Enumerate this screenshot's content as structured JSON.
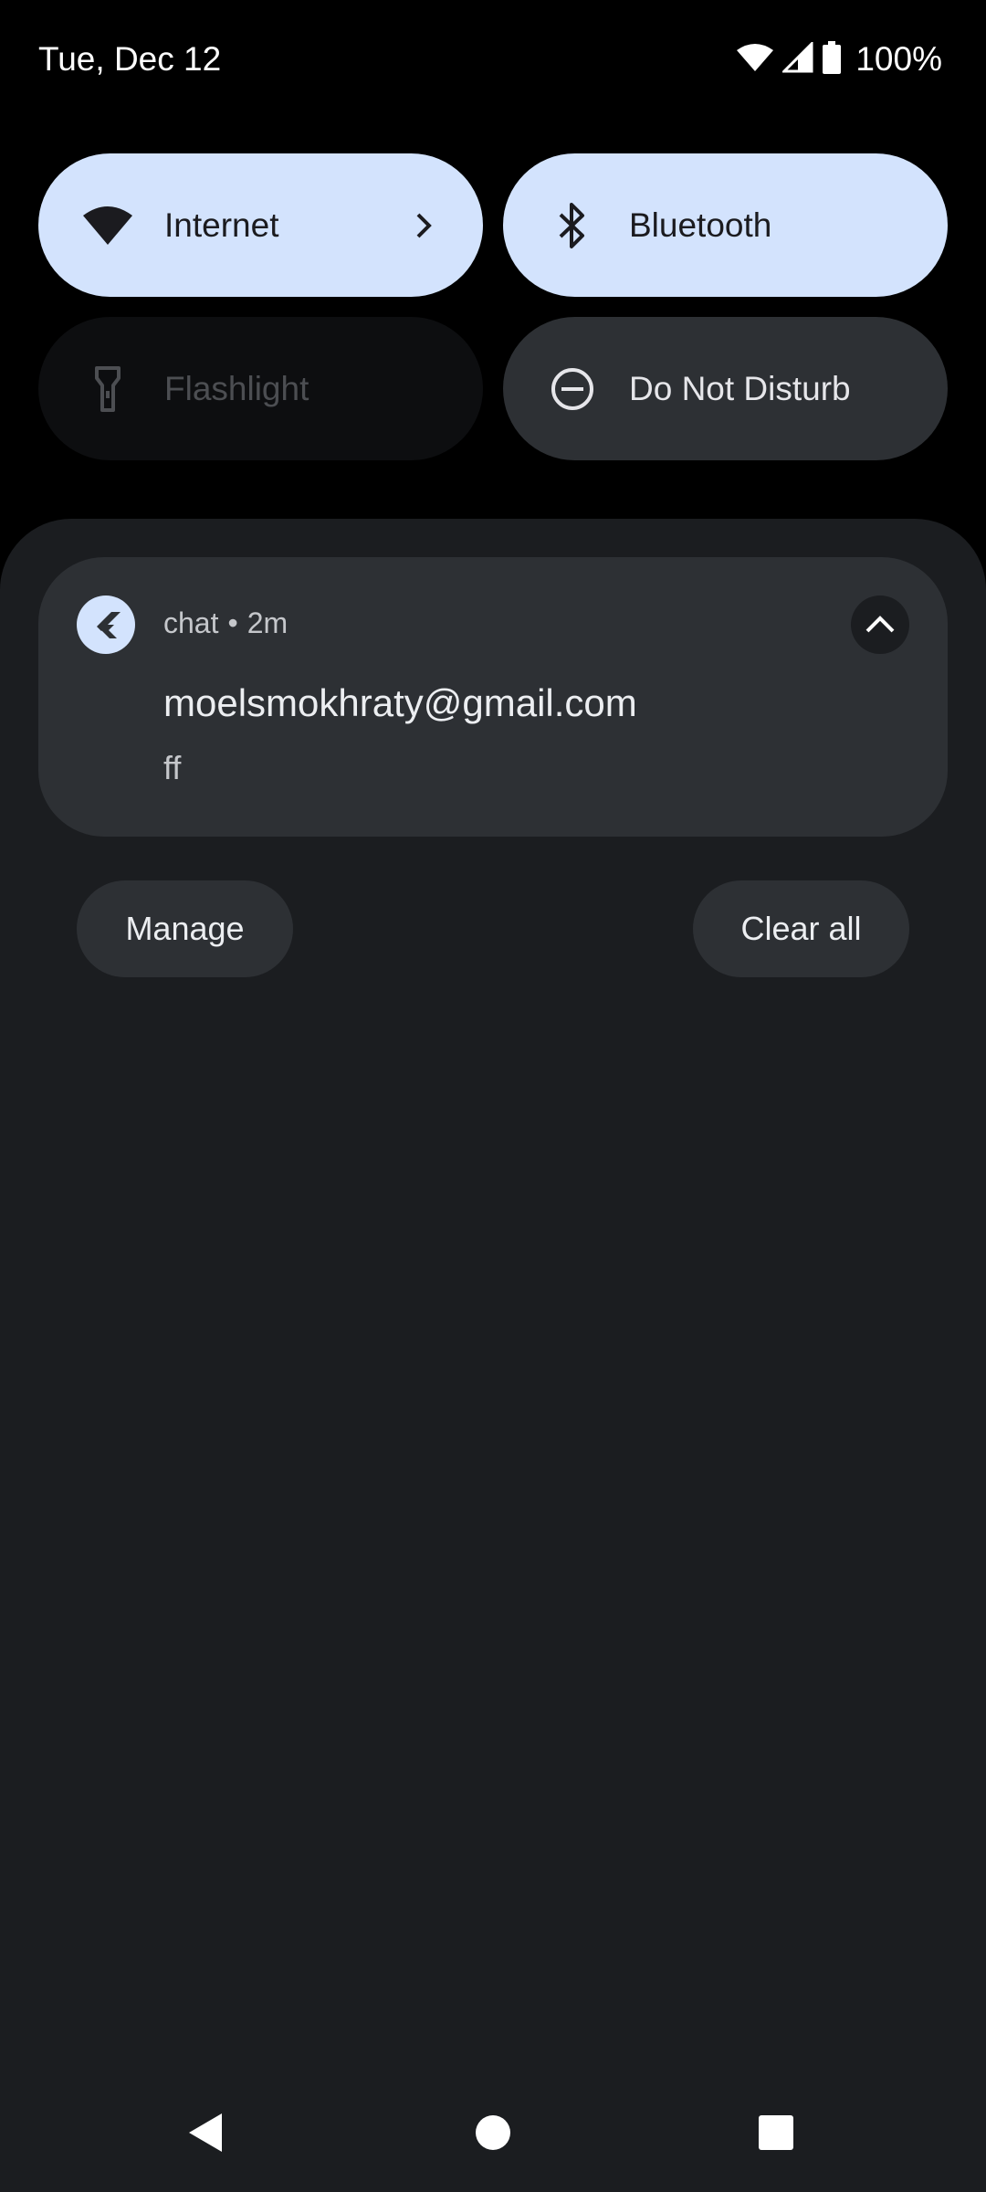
{
  "status_bar": {
    "date": "Tue, Dec 12",
    "battery_percent": "100%",
    "icons": [
      "wifi-icon",
      "cell-signal-icon",
      "battery-icon"
    ]
  },
  "quick_settings": {
    "tiles": [
      {
        "label": "Internet",
        "icon": "wifi-icon",
        "state": "on",
        "has_chevron": true
      },
      {
        "label": "Bluetooth",
        "icon": "bluetooth-icon",
        "state": "on"
      },
      {
        "label": "Flashlight",
        "icon": "flashlight-icon",
        "state": "unavailable"
      },
      {
        "label": "Do Not Disturb",
        "icon": "do-not-disturb-icon",
        "state": "off"
      }
    ]
  },
  "notification": {
    "app_name": "chat",
    "separator": "•",
    "time": "2m",
    "title": "moelsmokhraty@gmail.com",
    "text": "ff",
    "app_icon": "flutter-icon",
    "expand_icon": "chevron-up-icon"
  },
  "actions": {
    "manage_label": "Manage",
    "clear_all_label": "Clear all"
  },
  "navigation": {
    "buttons": [
      "back-icon",
      "home-icon",
      "recents-icon"
    ]
  },
  "colors": {
    "tile_on": "#d3e3fd",
    "tile_off": "#2d3034",
    "shade_bg": "#1b1d20"
  }
}
